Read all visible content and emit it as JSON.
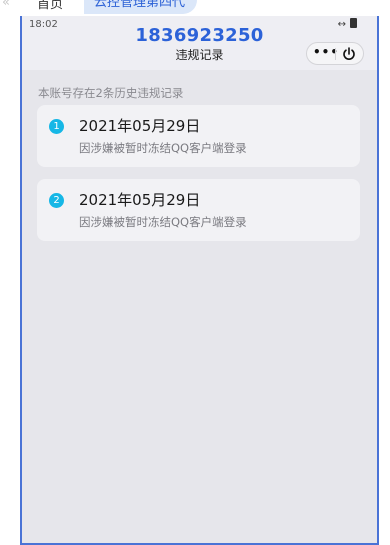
{
  "browser": {
    "tabs": [
      {
        "label": "首页"
      },
      {
        "label": "云控管理第四代"
      }
    ]
  },
  "status_bar": {
    "time": "18:02"
  },
  "header": {
    "account_number": "1836923250",
    "subtitle": "违规记录"
  },
  "notice": "本账号存在2条历史违规记录",
  "records": [
    {
      "index": "1",
      "date": "2021年05月29日",
      "reason": "因涉嫌被暂时冻结QQ客户端登录"
    },
    {
      "index": "2",
      "date": "2021年05月29日",
      "reason": "因涉嫌被暂时冻结QQ客户端登录"
    }
  ],
  "colors": {
    "accent": "#2c62d8",
    "badge": "#16b7e6",
    "frame": "#4a73d6"
  }
}
